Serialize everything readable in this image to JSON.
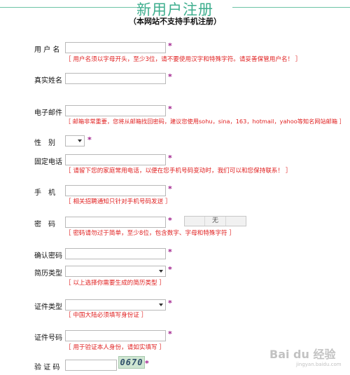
{
  "header": {
    "title": "新用户注册",
    "subtitle": "（本网站不支持手机注册）"
  },
  "form": {
    "username": {
      "label": "用 户 名",
      "value": "",
      "hint": "［ 用户名须以字母开头，至少3位，请不要使用汉字和特殊字符。请妥善保管用户名！ ］"
    },
    "realname": {
      "label": "真实姓名",
      "value": ""
    },
    "email": {
      "label": "电子邮件",
      "value": "",
      "hint": "［ 邮箱非常重要，您将从邮箱找回密码，建议您使用sohu，sina，163，hotmail，yahoo等知名网站邮箱 ］"
    },
    "gender": {
      "label": "性　别",
      "selected": ""
    },
    "phone": {
      "label": "固定电话",
      "value": "",
      "hint": "［ 请留下您的家庭常用电话，以便在您手机号码变动时，我们可以和您保持联系！ ］"
    },
    "mobile": {
      "label": "手　机",
      "value": "",
      "hint": "［ 相关招聘通知只针对手机号码发送 ］"
    },
    "password": {
      "label": "密　码",
      "value": "",
      "strength": "无",
      "hint": "［ 密码请勿过于简单，至少8位，包含数字、字母和特殊字符 ］"
    },
    "confirm": {
      "label": "确认密码",
      "value": ""
    },
    "resume_type": {
      "label": "简历类型",
      "selected": "",
      "hint": "［ 以上选择你需要生成的简历类型 ］"
    },
    "id_type": {
      "label": "证件类型",
      "selected": "",
      "hint": "［ 中国大陆必须填写身份证 ］"
    },
    "id_number": {
      "label": "证件号码",
      "value": "",
      "hint": "［ 用于验证本人身份，请如实填写 ］"
    },
    "captcha": {
      "label": "验 证 码",
      "value": "",
      "code": "0670"
    },
    "required_mark": "*"
  },
  "watermark": {
    "text": "Bai du 经验",
    "sub": "jingyan.baidu.com"
  }
}
